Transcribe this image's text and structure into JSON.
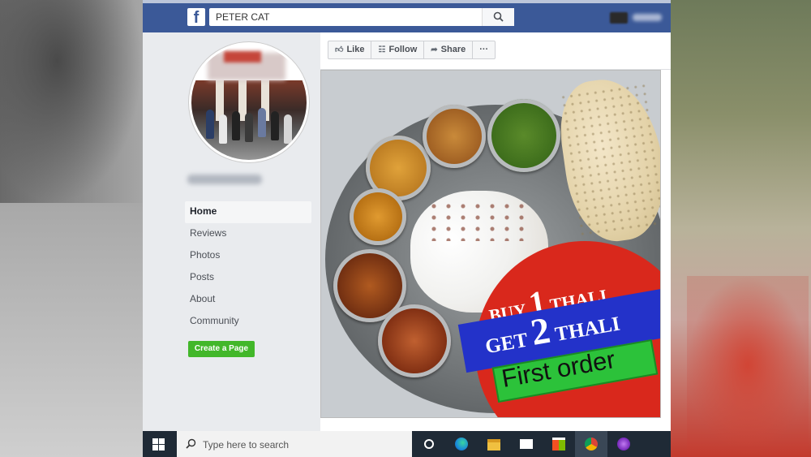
{
  "browser": {
    "search_value": "PETER CAT",
    "brand_color": "#3b5998"
  },
  "page": {
    "nav": [
      {
        "label": "Home",
        "active": true
      },
      {
        "label": "Reviews"
      },
      {
        "label": "Photos"
      },
      {
        "label": "Posts"
      },
      {
        "label": "About"
      },
      {
        "label": "Community"
      }
    ],
    "create_page_label": "Create a Page",
    "actions": [
      {
        "label": "Like",
        "icon": "thumbs-up-icon"
      },
      {
        "label": "Follow",
        "icon": "rss-icon"
      },
      {
        "label": "Share",
        "icon": "share-arrow-icon"
      },
      {
        "label": "···",
        "icon": "more-icon"
      }
    ]
  },
  "promo": {
    "line1_prefix": "BUY",
    "line1_number": "1",
    "line1_suffix": "THALI",
    "line2_prefix": "GET",
    "line2_number": "2",
    "line2_suffix": "THALI",
    "line3": "First order"
  },
  "taskbar": {
    "search_placeholder": "Type here to search",
    "apps": [
      "task-view-icon",
      "edge-icon",
      "file-explorer-icon",
      "mail-icon",
      "store-icon",
      "chrome-icon",
      "app-purple-icon"
    ]
  }
}
